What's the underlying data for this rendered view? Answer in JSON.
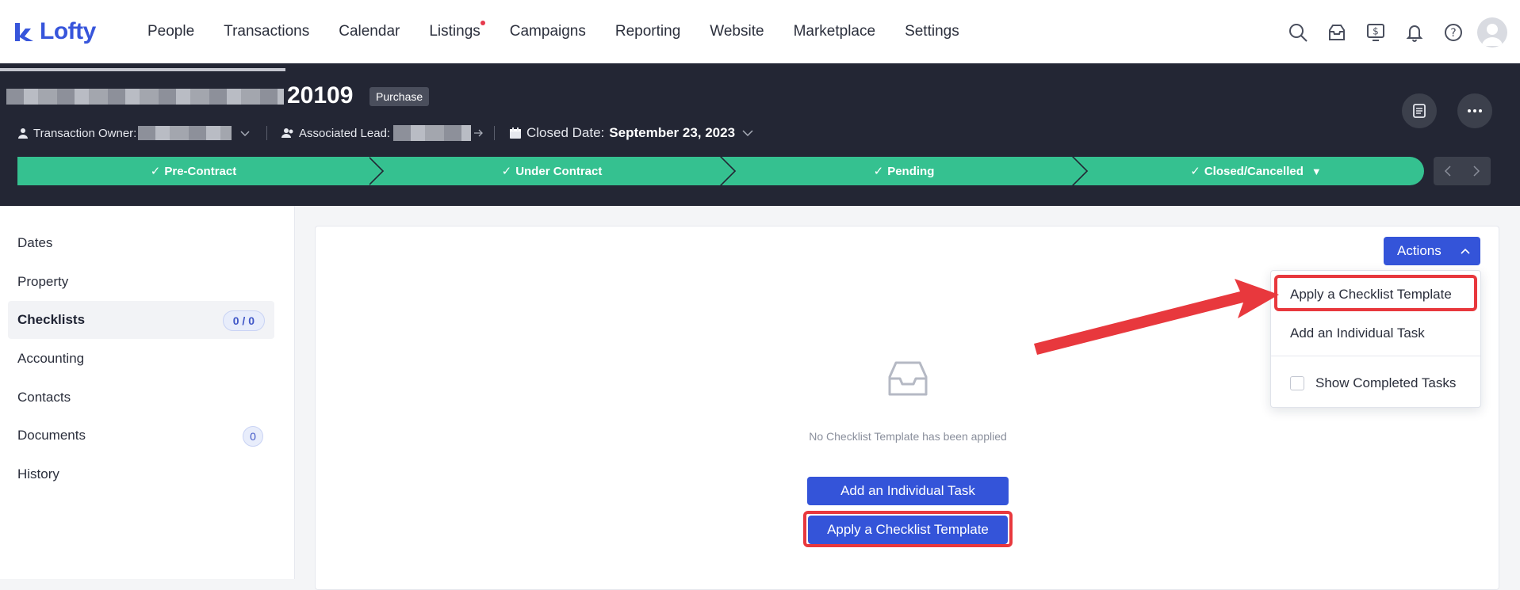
{
  "brand": {
    "name": "Lofty",
    "color": "#3755db"
  },
  "nav": {
    "items": [
      {
        "label": "People"
      },
      {
        "label": "Transactions"
      },
      {
        "label": "Calendar"
      },
      {
        "label": "Listings",
        "has_dot": true
      },
      {
        "label": "Campaigns"
      },
      {
        "label": "Reporting"
      },
      {
        "label": "Website"
      },
      {
        "label": "Marketplace"
      },
      {
        "label": "Settings"
      }
    ],
    "icons": [
      "search-icon",
      "inbox-icon",
      "dollar-screen-icon",
      "bell-icon",
      "help-icon",
      "avatar"
    ]
  },
  "transaction": {
    "title_suffix": "20109",
    "type_badge": "Purchase",
    "owner_label": "Transaction Owner:",
    "lead_label": "Associated Lead:",
    "closed_label": "Closed Date:",
    "closed_value": "September 23, 2023"
  },
  "stages": [
    {
      "label": "Pre-Contract"
    },
    {
      "label": "Under Contract"
    },
    {
      "label": "Pending"
    },
    {
      "label": "Closed/Cancelled"
    }
  ],
  "sidebar": {
    "items": [
      {
        "label": "Dates"
      },
      {
        "label": "Property"
      },
      {
        "label": "Checklists",
        "badge": "0 / 0",
        "active": true
      },
      {
        "label": "Accounting"
      },
      {
        "label": "Contacts"
      },
      {
        "label": "Documents",
        "badge": "0"
      },
      {
        "label": "History"
      }
    ]
  },
  "actions": {
    "button_label": "Actions",
    "menu": {
      "apply_template": "Apply a Checklist Template",
      "add_task": "Add an Individual Task",
      "show_completed": "Show Completed Tasks"
    }
  },
  "empty_state": {
    "message": "No Checklist Template has been applied",
    "add_task_button": "Add an Individual Task",
    "apply_template_button": "Apply a Checklist Template"
  },
  "colors": {
    "primary": "#3454d9",
    "stage_green": "#35c190",
    "header_dark": "#232634",
    "highlight_red": "#e8383d"
  }
}
